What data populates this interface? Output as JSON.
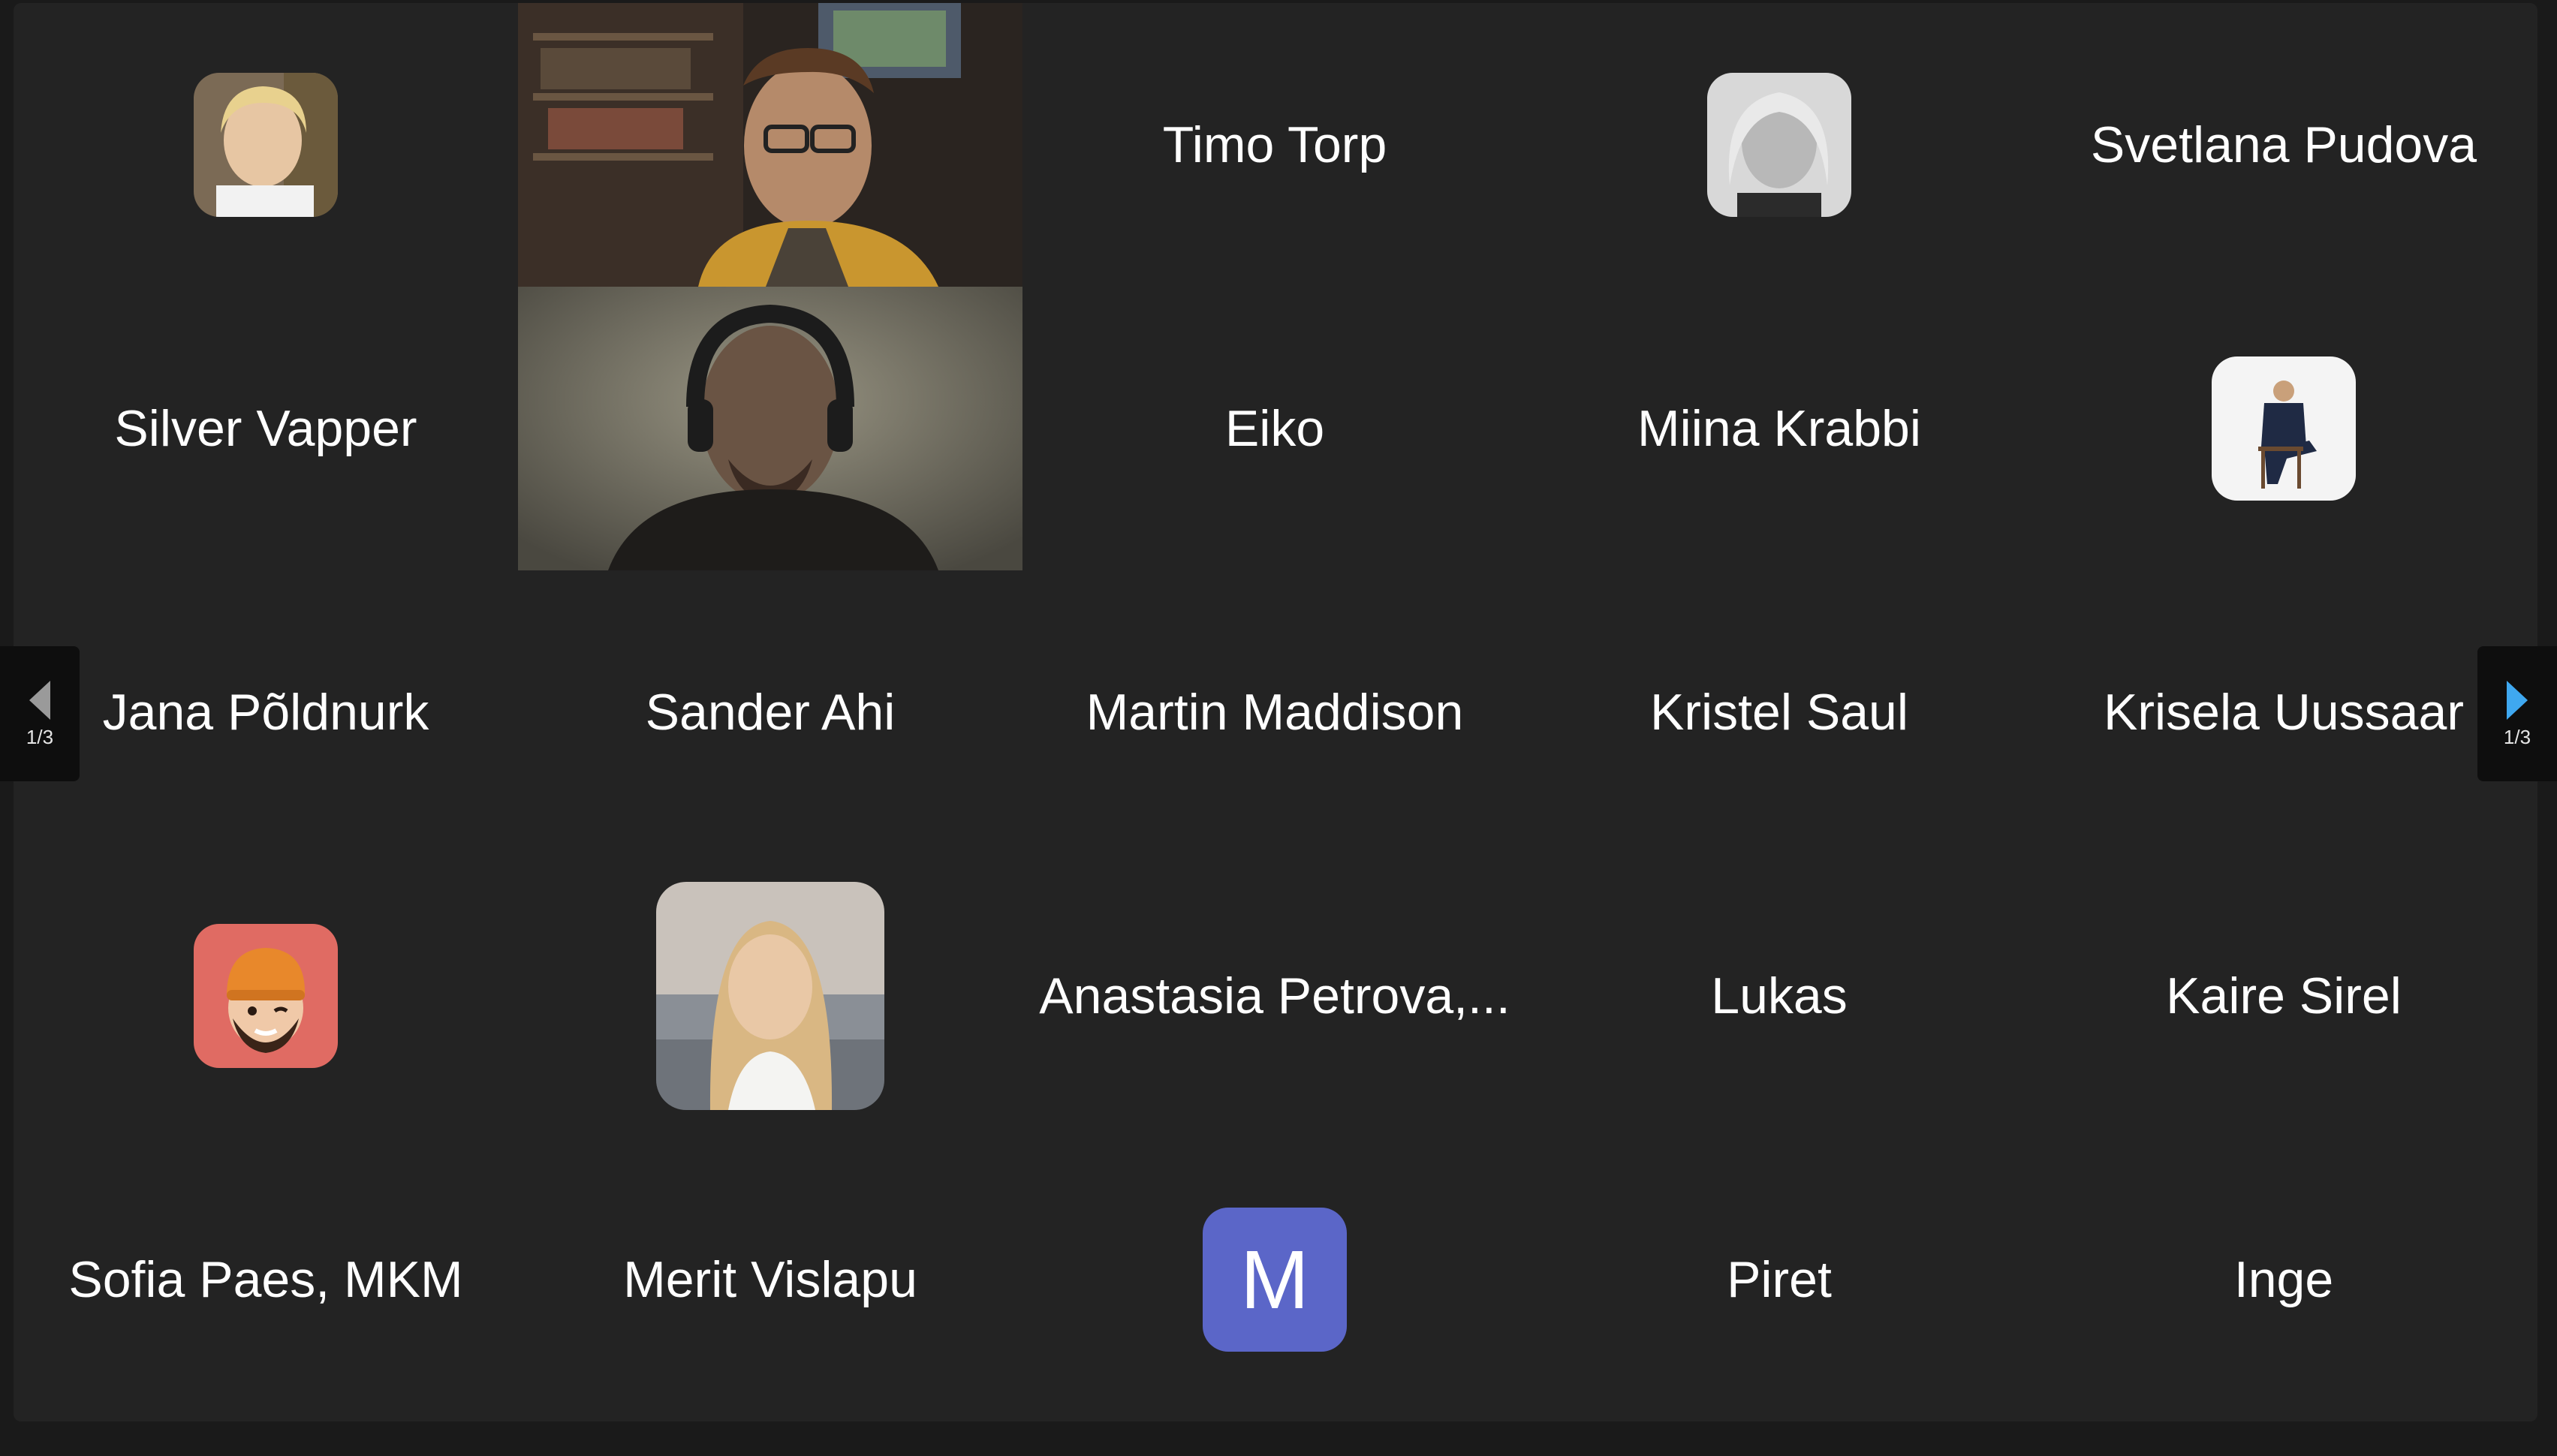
{
  "pager": {
    "left_indicator": "1/3",
    "right_indicator": "1/3"
  },
  "participants": {
    "silver_vapper": "Silver Vapper",
    "timo_torp": "Timo Torp",
    "svetlana_pudova": "Svetlana Pudova",
    "eiko": "Eiko",
    "miina_krabbi": "Miina Krabbi",
    "jana_poldnurk": "Jana Põldnurk",
    "sander_ahi": "Sander Ahi",
    "martin_maddison": "Martin Maddison",
    "kristel_saul": "Kristel Saul",
    "krisela_uussaar": "Krisela Uussaar",
    "anastasia_petrova": "Anastasia Petrova,...",
    "lukas": "Lukas",
    "kaire_sirel": "Kaire Sirel",
    "sofia_paes": "Sofia Paes, MKM",
    "merit_vislapu": "Merit Vislapu",
    "piret": "Piret",
    "inge": "Inge",
    "m_avatar_letter": "M"
  },
  "colors": {
    "background": "#1a1a1a",
    "tile_background": "#232323",
    "active_speaker_border": "#5fd34a",
    "letter_avatar": "#5b66c8",
    "nav_arrow_right": "#3fa8f0",
    "nav_arrow_left": "#9a9a9a"
  },
  "icons": {
    "nav_left": "caret-left-icon",
    "nav_right": "caret-right-icon"
  }
}
